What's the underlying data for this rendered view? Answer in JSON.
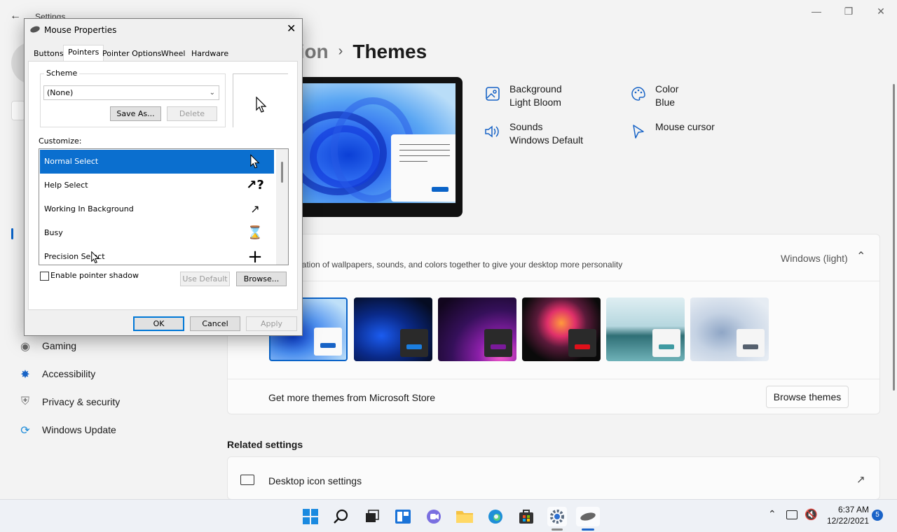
{
  "settings": {
    "window_title": "Settings",
    "breadcrumb_parent": "ization",
    "breadcrumb_current": "Themes",
    "properties": [
      {
        "label": "Background",
        "value": "Light Bloom",
        "icon": "image-icon"
      },
      {
        "label": "Color",
        "value": "Blue",
        "icon": "palette-icon"
      },
      {
        "label": "Sounds",
        "value": "Windows Default",
        "icon": "speaker-icon"
      },
      {
        "label": "Mouse cursor",
        "value": "",
        "icon": "cursor-icon"
      }
    ],
    "theme_description": "nation of wallpapers, sounds, and colors together to give your desktop more personality",
    "current_theme": "Windows (light)",
    "store_text": "Get more themes from Microsoft Store",
    "browse_themes": "Browse themes",
    "related_settings": "Related settings",
    "desktop_icon_settings": "Desktop icon settings",
    "nav": [
      {
        "label": "Gaming",
        "icon": "gamepad-icon"
      },
      {
        "label": "Accessibility",
        "icon": "accessibility-icon"
      },
      {
        "label": "Privacy & security",
        "icon": "shield-icon"
      },
      {
        "label": "Windows Update",
        "icon": "update-icon"
      }
    ]
  },
  "dialog": {
    "title": "Mouse Properties",
    "tabs": [
      "Buttons",
      "Pointers",
      "Pointer Options",
      "Wheel",
      "Hardware"
    ],
    "active_tab": "Pointers",
    "scheme_label": "Scheme",
    "scheme_value": "(None)",
    "save_as": "Save As...",
    "delete": "Delete",
    "customize_label": "Customize:",
    "cursor_list": [
      {
        "label": "Normal Select",
        "selected": true
      },
      {
        "label": "Help Select",
        "selected": false
      },
      {
        "label": "Working In Background",
        "selected": false
      },
      {
        "label": "Busy",
        "selected": false
      },
      {
        "label": "Precision Select",
        "selected": false
      }
    ],
    "enable_shadow": "Enable pointer shadow",
    "use_default": "Use Default",
    "browse": "Browse...",
    "ok": "OK",
    "cancel": "Cancel",
    "apply": "Apply"
  },
  "taskbar": {
    "time": "6:37 AM",
    "date": "12/22/2021",
    "notification_count": "5"
  }
}
